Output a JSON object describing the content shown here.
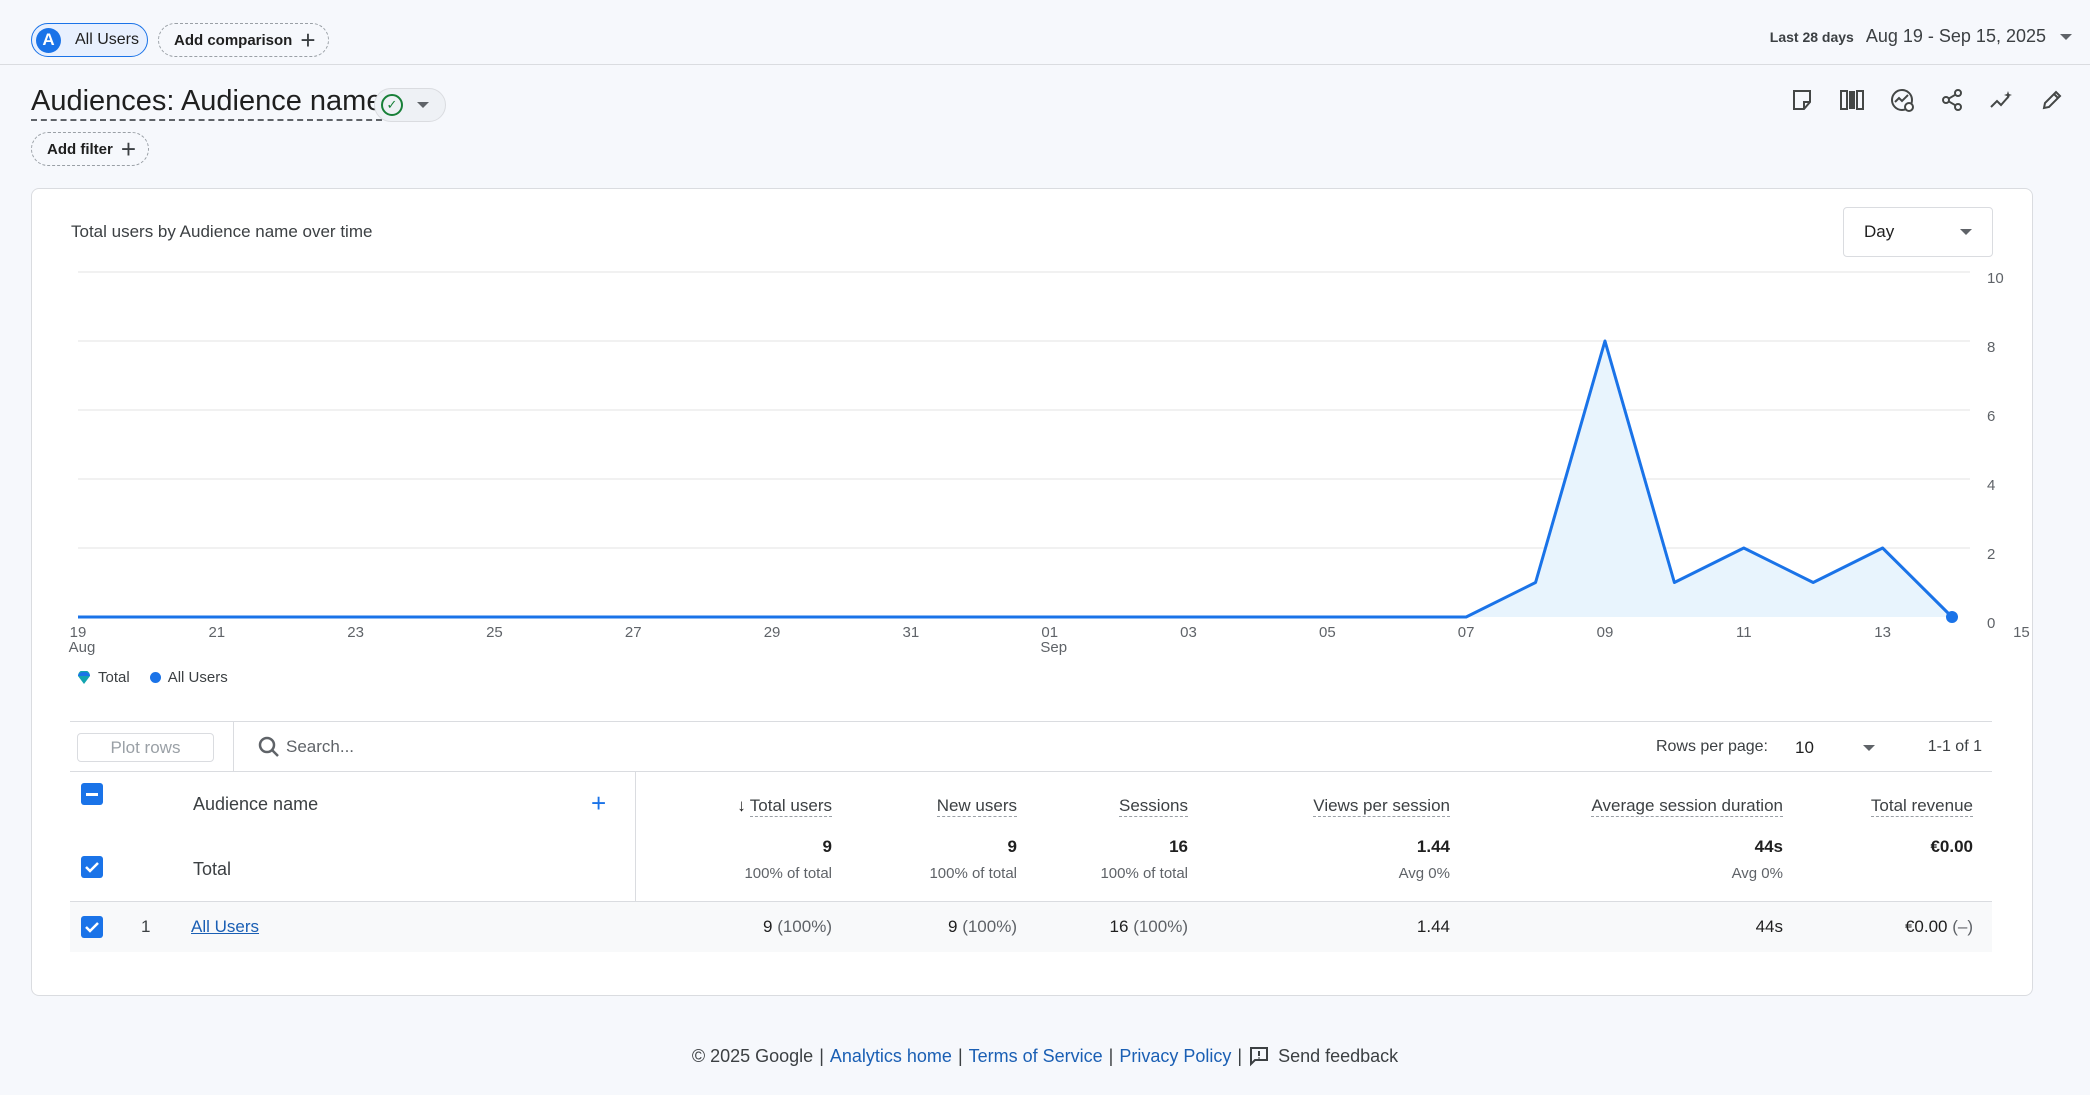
{
  "header": {
    "segment_chip": {
      "avatar": "A",
      "label": "All Users"
    },
    "add_comparison_label": "Add comparison",
    "date_prefix": "Last 28 days",
    "date_range": "Aug 19 - Sep 15, 2025"
  },
  "title": {
    "text": "Audiences: Audience name",
    "add_filter_label": "Add filter"
  },
  "toolbar_icons": [
    "note-icon",
    "compare-columns-icon",
    "insights-icon",
    "share-icon",
    "trending-icon",
    "edit-icon"
  ],
  "chart_card": {
    "title": "Total users by Audience name over time",
    "granularity": "Day"
  },
  "chart_data": {
    "type": "area",
    "x": [
      "2025-08-19",
      "2025-08-20",
      "2025-08-21",
      "2025-08-22",
      "2025-08-23",
      "2025-08-24",
      "2025-08-25",
      "2025-08-26",
      "2025-08-27",
      "2025-08-28",
      "2025-08-29",
      "2025-08-30",
      "2025-08-31",
      "2025-09-01",
      "2025-09-02",
      "2025-09-03",
      "2025-09-04",
      "2025-09-05",
      "2025-09-06",
      "2025-09-07",
      "2025-09-08",
      "2025-09-09",
      "2025-09-10",
      "2025-09-11",
      "2025-09-12",
      "2025-09-13",
      "2025-09-14",
      "2025-09-15"
    ],
    "series": [
      {
        "name": "All Users",
        "values": [
          0,
          0,
          0,
          0,
          0,
          0,
          0,
          0,
          0,
          0,
          0,
          0,
          0,
          0,
          0,
          0,
          0,
          0,
          0,
          0,
          0,
          1,
          8,
          1,
          2,
          1,
          2,
          0
        ]
      }
    ],
    "x_ticks": [
      {
        "day": "19",
        "month": "Aug"
      },
      {
        "day": "21",
        "month": ""
      },
      {
        "day": "23",
        "month": ""
      },
      {
        "day": "25",
        "month": ""
      },
      {
        "day": "27",
        "month": ""
      },
      {
        "day": "29",
        "month": ""
      },
      {
        "day": "31",
        "month": ""
      },
      {
        "day": "01",
        "month": "Sep"
      },
      {
        "day": "03",
        "month": ""
      },
      {
        "day": "05",
        "month": ""
      },
      {
        "day": "07",
        "month": ""
      },
      {
        "day": "09",
        "month": ""
      },
      {
        "day": "11",
        "month": ""
      },
      {
        "day": "13",
        "month": ""
      },
      {
        "day": "15",
        "month": ""
      }
    ],
    "y_ticks": [
      "0",
      "2",
      "4",
      "6",
      "8",
      "10"
    ],
    "ylim": [
      0,
      10
    ],
    "grid": true,
    "legend": [
      "Total",
      "All Users"
    ],
    "legend_position": "bottom-left",
    "colors": {
      "line": "#1a73e8",
      "fill": "#e8f4fd",
      "marker": "#1a73e8"
    }
  },
  "table": {
    "plot_rows_label": "Plot rows",
    "search_placeholder": "Search...",
    "rows_per_page_label": "Rows per page:",
    "rows_per_page": "10",
    "pager": "1-1 of 1",
    "dimension_header": "Audience name",
    "columns": [
      "Total users",
      "New users",
      "Sessions",
      "Views per session",
      "Average session duration",
      "Total revenue"
    ],
    "total_row": {
      "label": "Total",
      "values": [
        "9",
        "9",
        "16",
        "1.44",
        "44s",
        "€0.00"
      ],
      "subs": [
        "100% of total",
        "100% of total",
        "100% of total",
        "Avg 0%",
        "Avg 0%",
        ""
      ]
    },
    "rows": [
      {
        "index": "1",
        "name": "All Users",
        "values": [
          "9",
          "9",
          "16",
          "1.44",
          "44s",
          "€0.00"
        ],
        "pcts": [
          "(100%)",
          "(100%)",
          "(100%)",
          "",
          "",
          "(–)"
        ]
      }
    ]
  },
  "footer": {
    "copyright": "© 2025 Google",
    "sep": "|",
    "links": [
      "Analytics home",
      "Terms of Service",
      "Privacy Policy"
    ],
    "feedback": "Send feedback"
  }
}
